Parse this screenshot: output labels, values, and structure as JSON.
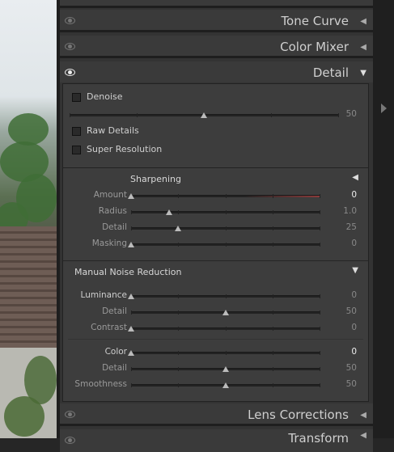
{
  "colors": {
    "panel_bg": "#333333",
    "section_bg": "#3d3d3d",
    "accent_red": "#8a3a3a"
  },
  "sections": {
    "tone_curve": "Tone Curve",
    "color_mixer": "Color Mixer",
    "detail": "Detail",
    "lens_corrections": "Lens Corrections",
    "transform_partial": "Transform"
  },
  "detail": {
    "denoise_label": "Denoise",
    "denoise_value": "50",
    "denoise_level": 0.5,
    "raw_details_label": "Raw Details",
    "super_resolution_label": "Super Resolution"
  },
  "sharpening": {
    "title": "Sharpening",
    "amount": {
      "label": "Amount",
      "value": "0",
      "level": 0.0
    },
    "radius": {
      "label": "Radius",
      "value": "1.0",
      "level": 0.2
    },
    "detail": {
      "label": "Detail",
      "value": "25",
      "level": 0.25
    },
    "masking": {
      "label": "Masking",
      "value": "0",
      "level": 0.0
    }
  },
  "noise": {
    "title": "Manual Noise Reduction",
    "luminance": {
      "label": "Luminance",
      "value": "0",
      "level": 0.0
    },
    "lum_detail": {
      "label": "Detail",
      "value": "50",
      "level": 0.5
    },
    "contrast": {
      "label": "Contrast",
      "value": "0",
      "level": 0.0
    },
    "color": {
      "label": "Color",
      "value": "0",
      "level": 0.0
    },
    "color_detail": {
      "label": "Detail",
      "value": "50",
      "level": 0.5
    },
    "smoothness": {
      "label": "Smoothness",
      "value": "50",
      "level": 0.5
    }
  }
}
